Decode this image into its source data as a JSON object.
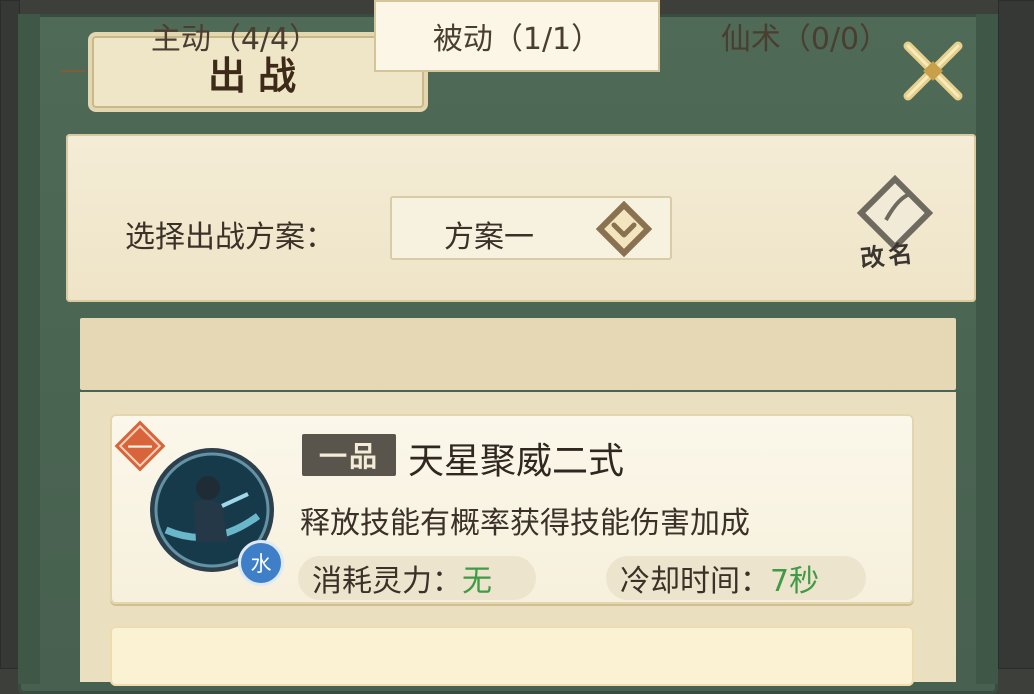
{
  "dialog": {
    "title": "出战",
    "close_icon": "close-x-icon"
  },
  "plan": {
    "label": "选择出战方案：",
    "selected": "方案一",
    "rename_label": "改名"
  },
  "tabs": [
    {
      "label": "主动（4/4）",
      "active": false
    },
    {
      "label": "被动（1/1）",
      "active": true
    },
    {
      "label": "仙术（0/0）",
      "active": false
    }
  ],
  "skill": {
    "rank_badge": "一",
    "grade": "一品",
    "name": "天星聚威二式",
    "description": "释放技能有概率获得技能伤害加成",
    "element": "水",
    "cost_label": "消耗灵力：",
    "cost_value": "无",
    "cooldown_label": "冷却时间：",
    "cooldown_value": "7秒"
  },
  "colors": {
    "frame_green": "#4f6a57",
    "parchment": "#f4ecd6",
    "gold": "#d9b45a",
    "value_green": "#3f9b45",
    "rank_red": "#d8643c",
    "water_blue": "#3f7fc8"
  }
}
